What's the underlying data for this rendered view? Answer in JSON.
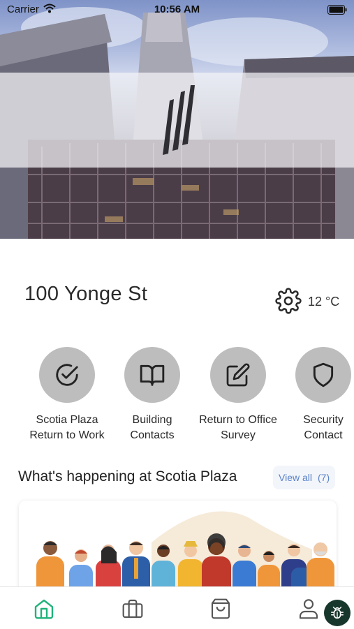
{
  "status_bar": {
    "carrier": "Carrier",
    "time": "10:56 AM"
  },
  "location": {
    "name": "100 Yonge St",
    "temperature": "12 °C"
  },
  "quick_actions": [
    {
      "label": "Scotia Plaza\nReturn to Work",
      "icon": "check-circle-icon"
    },
    {
      "label": "Building\nContacts",
      "icon": "book-open-icon"
    },
    {
      "label": "Return to Office\nSurvey",
      "icon": "edit-square-icon"
    },
    {
      "label": "Security\nContact",
      "icon": "shield-icon"
    }
  ],
  "section": {
    "title": "What's happening at Scotia Plaza",
    "view_all": "View all",
    "view_all_count": "(7)"
  },
  "tab_bar": {
    "items": [
      "home-icon",
      "briefcase-icon",
      "shopping-bag-icon",
      "profile-icon"
    ],
    "active": "home-icon"
  },
  "colors": {
    "accent": "#1fb37a",
    "action_circle": "#bdbdbd",
    "link": "#5a82c8",
    "debug_bg": "#17372c"
  }
}
